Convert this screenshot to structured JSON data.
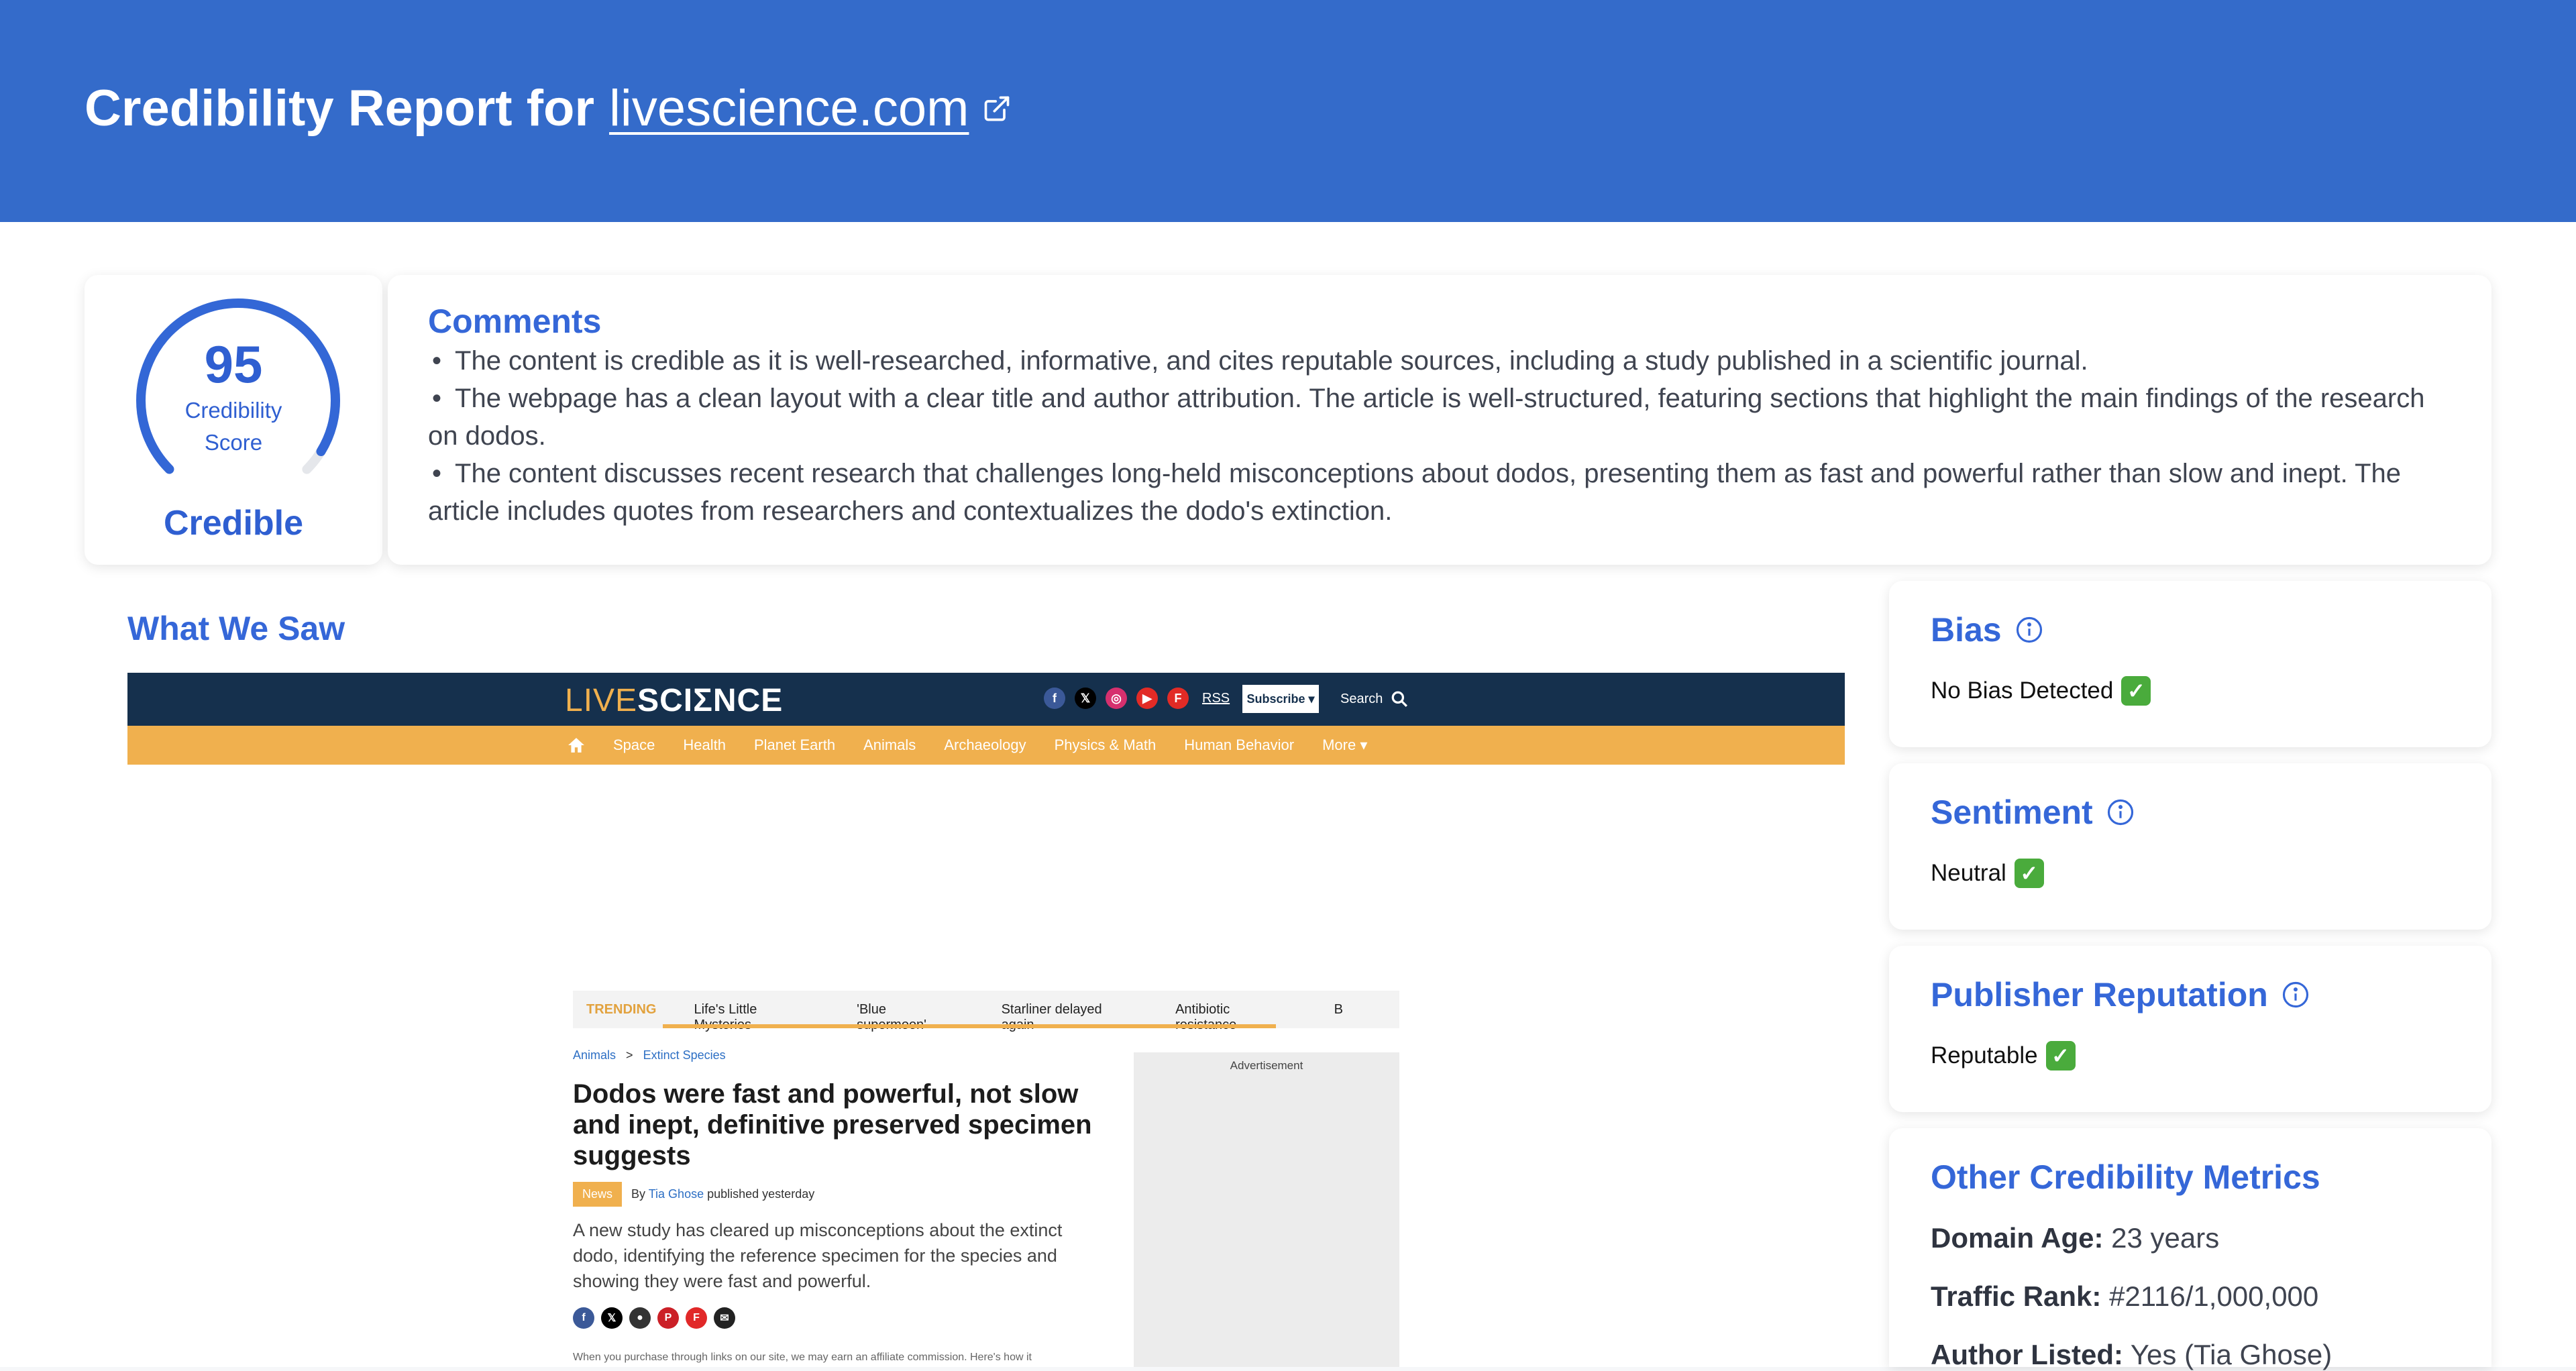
{
  "header": {
    "title_prefix": "Credibility Report for",
    "domain": "livescience.com"
  },
  "score": {
    "value": "95",
    "caption_line1": "Credibility",
    "caption_line2": "Score",
    "verdict": "Credible",
    "fraction": 0.95
  },
  "comments": {
    "title": "Comments",
    "items": [
      "The content is credible as it is well-researched, informative, and cites reputable sources, including a study published in a scientific journal.",
      "The webpage has a clean layout with a clear title and author attribution. The article is well-structured, featuring sections that highlight the main findings of the research on dodos.",
      "The content discusses recent research that challenges long-held misconceptions about dodos, presenting them as fast and powerful rather than slow and inept. The article includes quotes from researchers and contextualizes the dodo's extinction."
    ]
  },
  "what_we_saw": {
    "title": "What We Saw",
    "screenshot": {
      "logo_live": "LIVE",
      "logo_science": "SCIΣNCE",
      "rss": "RSS",
      "subscribe": "Subscribe ▾",
      "search": "Search",
      "nav": [
        "Space",
        "Health",
        "Planet Earth",
        "Animals",
        "Archaeology",
        "Physics & Math",
        "Human Behavior",
        "More ▾"
      ],
      "trending_label": "TRENDING",
      "trending": [
        "Life's Little Mysteries",
        "'Blue supermoon'",
        "Starliner delayed again",
        "Antibiotic resistance",
        "B"
      ],
      "crumbs": [
        "Animals",
        ">",
        "Extinct Species"
      ],
      "article_title": "Dodos were fast and powerful, not slow and inept, definitive preserved specimen suggests",
      "tag": "News",
      "by": "By",
      "author": "Tia Ghose",
      "published": "published yesterday",
      "lede": "A new study has cleared up misconceptions about the extinct dodo, identifying the reference specimen for the species and showing they were fast and powerful.",
      "affiliate": "When you purchase through links on our site, we may earn an affiliate commission. Here's how it",
      "ad_label": "Advertisement"
    }
  },
  "bias": {
    "title": "Bias",
    "value": "No Bias Detected"
  },
  "sentiment": {
    "title": "Sentiment",
    "value": "Neutral"
  },
  "publisher": {
    "title": "Publisher Reputation",
    "value": "Reputable"
  },
  "other_metrics": {
    "title": "Other Credibility Metrics",
    "domain_age_label": "Domain Age:",
    "domain_age_value": "23 years",
    "traffic_rank_label": "Traffic Rank:",
    "traffic_rank_value": "#2116/1,000,000",
    "author_label": "Author Listed:",
    "author_value": "Yes (Tia Ghose)"
  },
  "colors": {
    "header_bg": "#346bca",
    "accent": "#3567d8",
    "gauge": "#3367d6",
    "check": "#4aab3c",
    "ls_navy": "#15304d",
    "ls_orange": "#f0b04e"
  }
}
